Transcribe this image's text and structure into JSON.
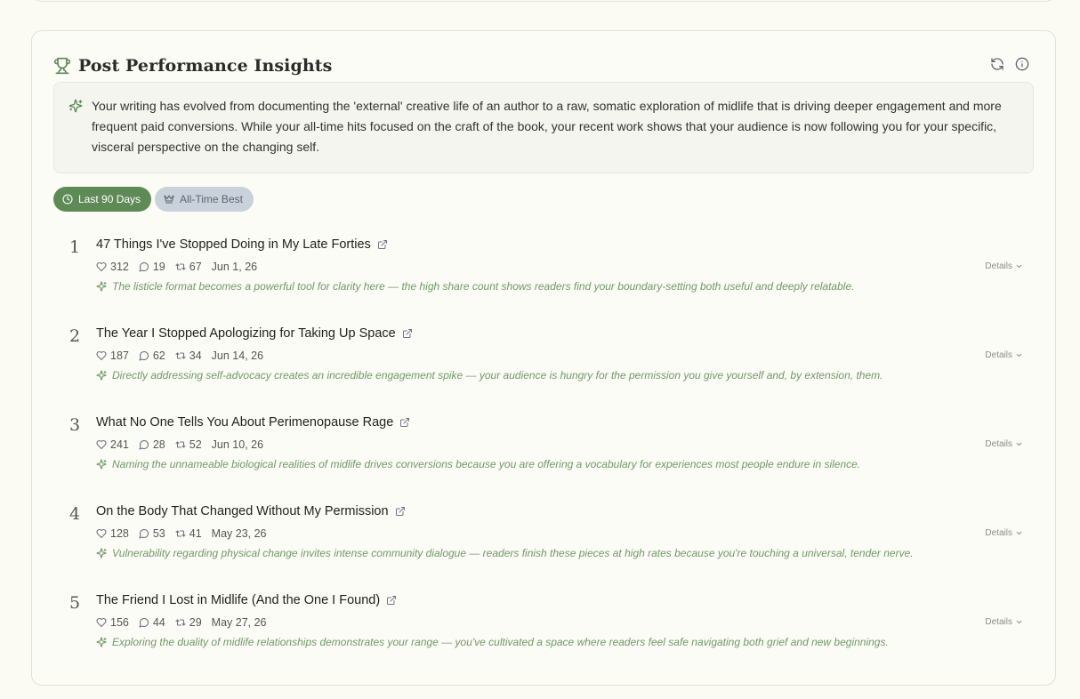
{
  "header": {
    "title": "Post Performance Insights",
    "icons": [
      "trophy-icon",
      "refresh-icon",
      "info-icon"
    ]
  },
  "summary": {
    "text": "Your writing has evolved from documenting the 'external' creative life of an author to a raw, somatic exploration of midlife that is driving deeper engagement and more frequent paid conversions. While your all-time hits focused on the craft of the book, your recent work shows that your audience is now following you for your specific, visceral perspective on the changing self."
  },
  "tabs": [
    {
      "label": "Last 90 Days",
      "icon": "clock-icon",
      "active": true
    },
    {
      "label": "All-Time Best",
      "icon": "crown-icon",
      "active": false
    }
  ],
  "details_label": "Details",
  "posts": [
    {
      "rank": "1",
      "title": "47 Things I've Stopped Doing in My Late Forties",
      "likes": "312",
      "comments": "19",
      "restacks": "67",
      "date": "Jun 1, 26",
      "insight": "The listicle format becomes a powerful tool for clarity here — the high share count shows readers find your boundary-setting both useful and deeply relatable."
    },
    {
      "rank": "2",
      "title": "The Year I Stopped Apologizing for Taking Up Space",
      "likes": "187",
      "comments": "62",
      "restacks": "34",
      "date": "Jun 14, 26",
      "insight": "Directly addressing self-advocacy creates an incredible engagement spike — your audience is hungry for the permission you give yourself and, by extension, them."
    },
    {
      "rank": "3",
      "title": "What No One Tells You About Perimenopause Rage",
      "likes": "241",
      "comments": "28",
      "restacks": "52",
      "date": "Jun 10, 26",
      "insight": "Naming the unnameable biological realities of midlife drives conversions because you are offering a vocabulary for experiences most people endure in silence."
    },
    {
      "rank": "4",
      "title": "On the Body That Changed Without My Permission",
      "likes": "128",
      "comments": "53",
      "restacks": "41",
      "date": "May 23, 26",
      "insight": "Vulnerability regarding physical change invites intense community dialogue — readers finish these pieces at high rates because you're touching a universal, tender nerve."
    },
    {
      "rank": "5",
      "title": "The Friend I Lost in Midlife (And the One I Found)",
      "likes": "156",
      "comments": "44",
      "restacks": "29",
      "date": "May 27, 26",
      "insight": "Exploring the duality of midlife relationships demonstrates your range — you've cultivated a space where readers feel safe navigating both grief and new beginnings."
    }
  ],
  "colors": {
    "accent": "#5e8a56",
    "insight": "#6f9966",
    "inactive_tab": "#c9d1da"
  }
}
